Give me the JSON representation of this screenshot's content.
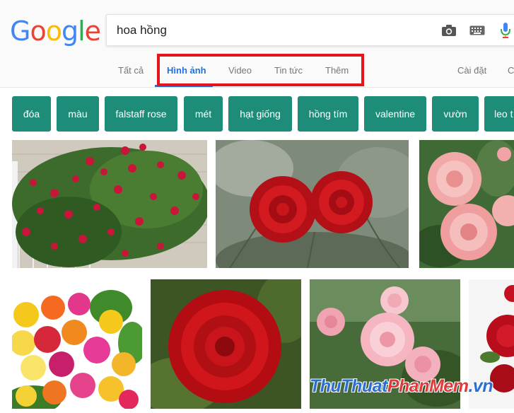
{
  "logo": {
    "letters": [
      "G",
      "o",
      "o",
      "g",
      "l",
      "e"
    ],
    "colors": [
      "#4285f4",
      "#ea4335",
      "#fbbc05",
      "#4285f4",
      "#34a853",
      "#ea4335"
    ]
  },
  "search": {
    "value": "hoa hồng",
    "camera_icon": "camera-icon",
    "keyboard_icon": "keyboard-icon",
    "mic_icon": "microphone-icon"
  },
  "tabs": [
    {
      "label": "Tất cả",
      "active": false
    },
    {
      "label": "Hình ảnh",
      "active": true
    },
    {
      "label": "Video",
      "active": false
    },
    {
      "label": "Tin tức",
      "active": false
    },
    {
      "label": "Thêm",
      "active": false
    },
    {
      "label": "Cài đặt",
      "active": false
    },
    {
      "label": "C",
      "active": false
    }
  ],
  "chips": [
    "đóa",
    "màu",
    "falstaff rose",
    "mét",
    "hạt giống",
    "hồng tím",
    "valentine",
    "vườn",
    "leo t"
  ],
  "colors": {
    "accent": "#1a73e8",
    "chip": "#1d8c78",
    "highlight": "#e8141c"
  },
  "watermark": {
    "part1": "ThuThuat",
    "part2": "PhanMem",
    "part3": ".vn"
  }
}
